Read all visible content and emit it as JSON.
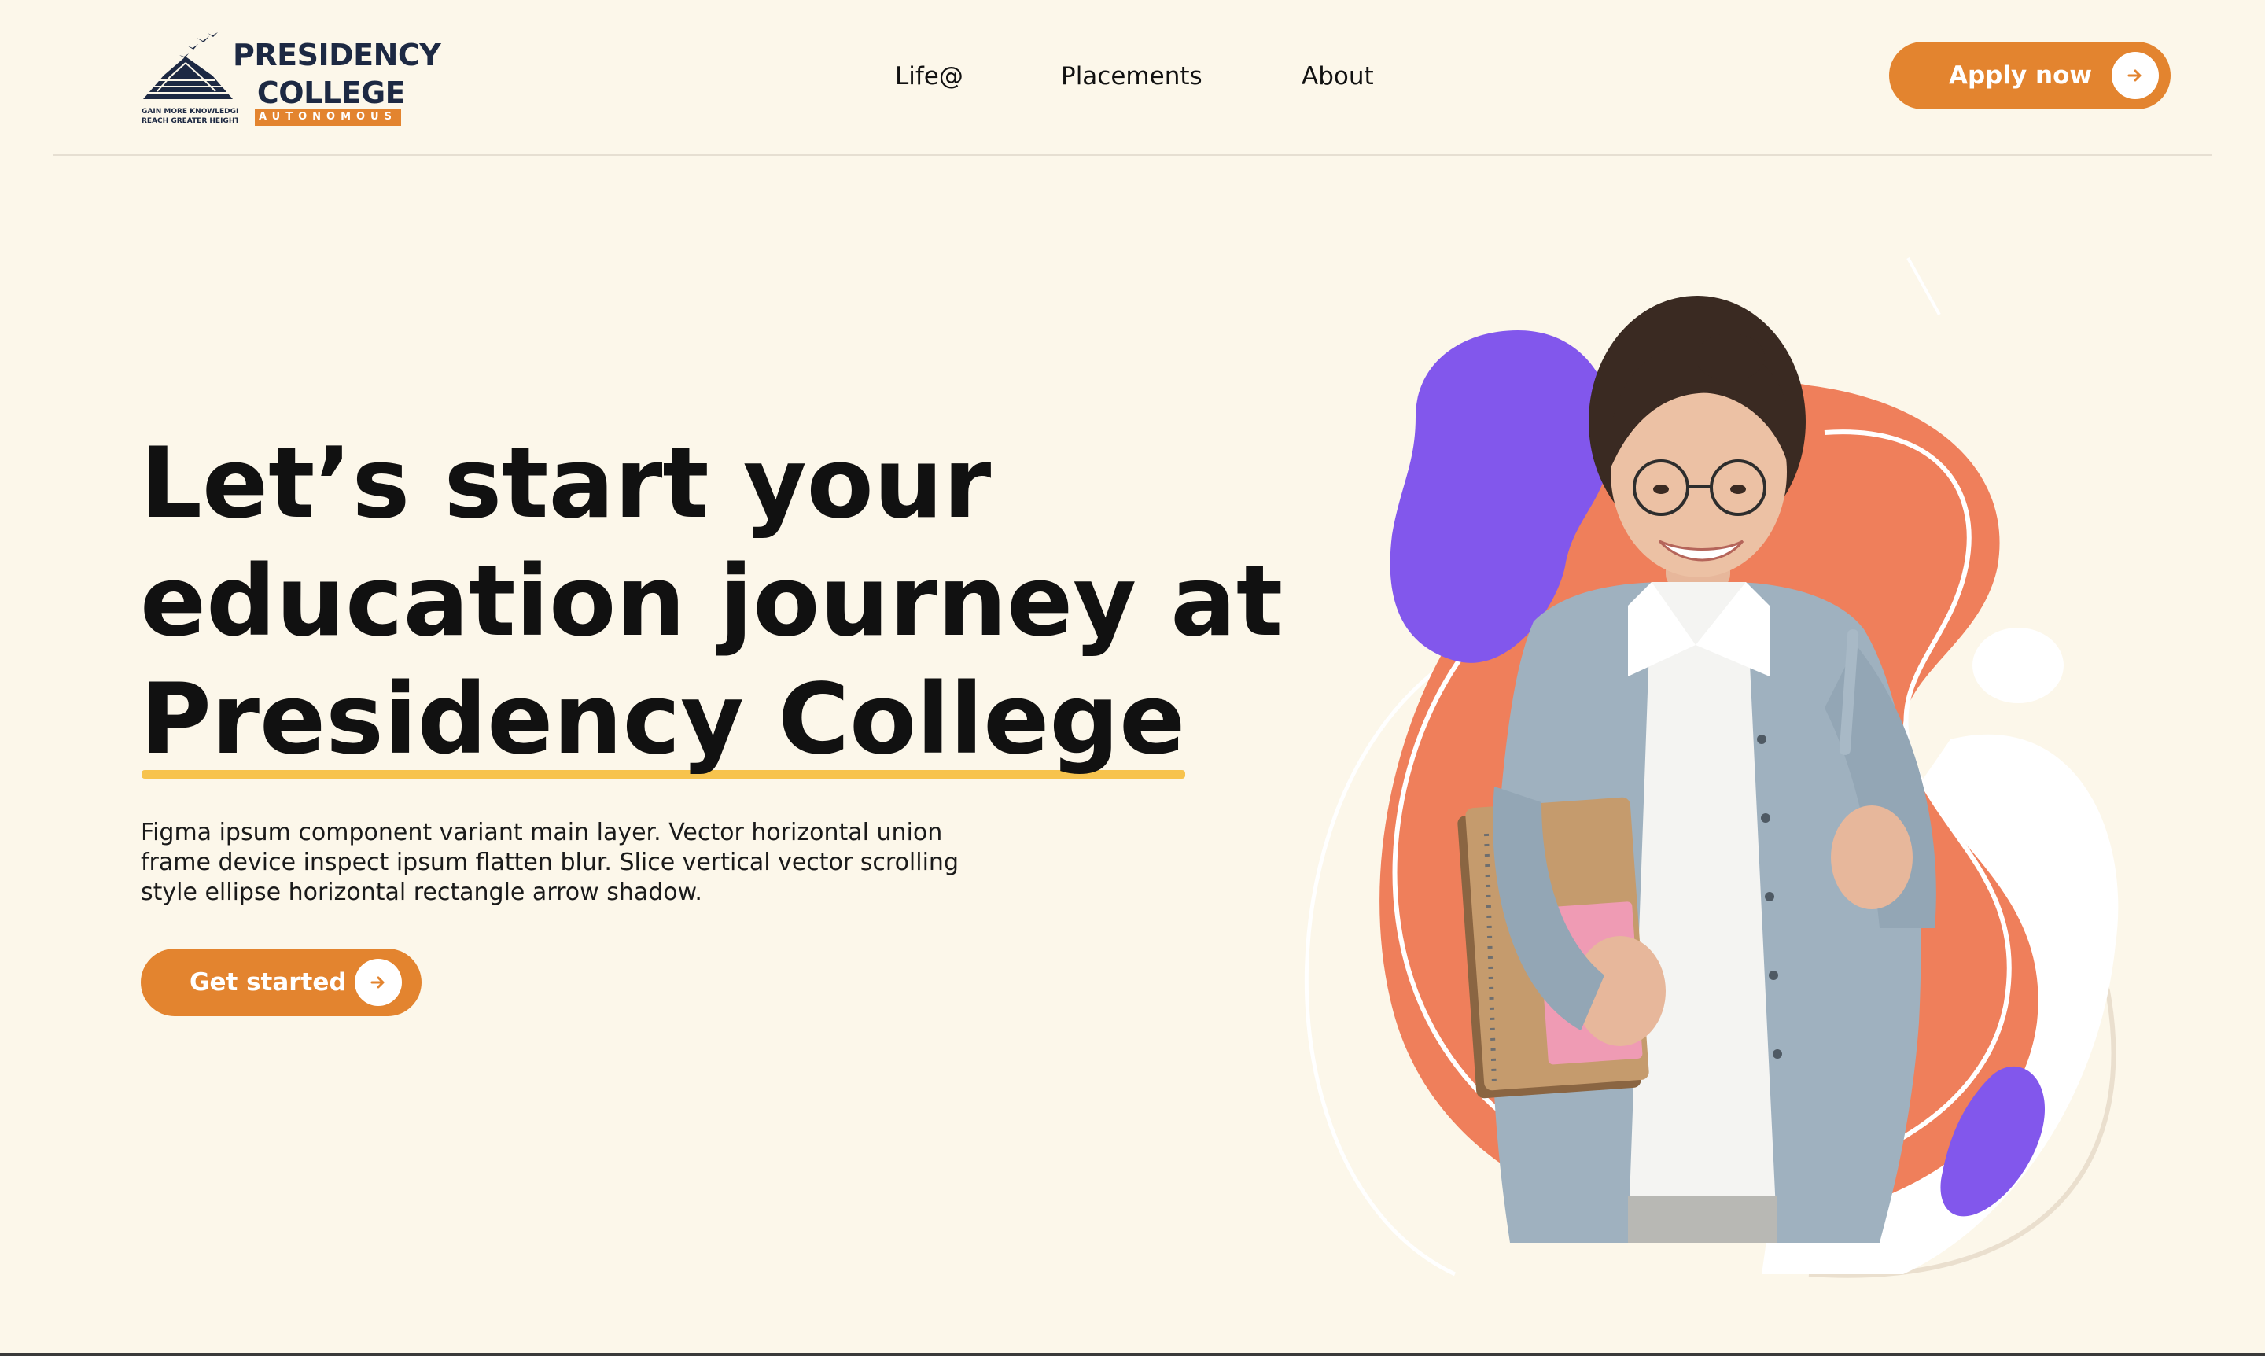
{
  "brand": {
    "name_line1": "PRESIDENCY",
    "name_line2": "COLLEGE",
    "badge": "AUTONOMOUS",
    "tagline_line1": "GAIN MORE KNOWLEDGE",
    "tagline_line2": "REACH GREATER HEIGHTS"
  },
  "nav": {
    "items": [
      {
        "label": "Life@"
      },
      {
        "label": "Placements"
      },
      {
        "label": "About"
      }
    ]
  },
  "header": {
    "apply_label": "Apply now",
    "apply_icon": "arrow-right-icon"
  },
  "hero": {
    "title_line1": "Let’s start your",
    "title_line2": "education journey at",
    "title_line3": "Presidency College",
    "description_line1": "Figma ipsum component variant main layer. Vector horizontal union",
    "description_line2": "frame device inspect ipsum flatten blur. Slice vertical vector scrolling",
    "description_line3": "style ellipse horizontal rectangle arrow shadow.",
    "cta_label": "Get started",
    "cta_icon": "arrow-right-icon"
  },
  "colors": {
    "background": "#fcf7ea",
    "accent_orange": "#e3842f",
    "blob_orange": "#ef7f5b",
    "blob_purple": "#8257ec",
    "highlight_yellow": "#f7c34d",
    "navy": "#1d2943"
  }
}
